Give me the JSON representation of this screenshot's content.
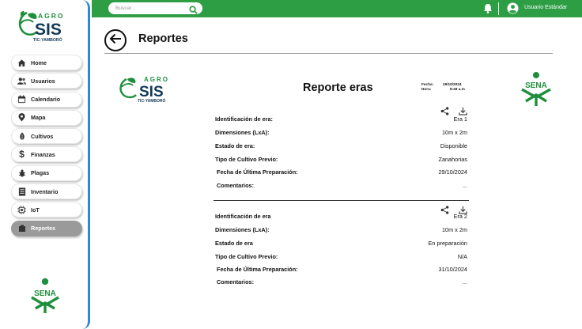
{
  "app": {
    "logo": {
      "word1": "AGRO",
      "word2": "SIS",
      "word3": "TIC-YAMBORÓ"
    },
    "sena_logo": "SENA"
  },
  "sidebar": {
    "items": [
      {
        "label": "Home",
        "icon": "home-icon"
      },
      {
        "label": "Usuarios",
        "icon": "users-icon"
      },
      {
        "label": "Calendario",
        "icon": "calendar-icon"
      },
      {
        "label": "Mapa",
        "icon": "map-pin-icon"
      },
      {
        "label": "Cultivos",
        "icon": "leaf-icon"
      },
      {
        "label": "Finanzas",
        "icon": "dollar-icon"
      },
      {
        "label": "Plagas",
        "icon": "bug-icon"
      },
      {
        "label": "Inventario",
        "icon": "inventory-icon"
      },
      {
        "label": "IoT",
        "icon": "chip-icon"
      },
      {
        "label": "Reportes",
        "icon": "report-icon",
        "active": true
      }
    ]
  },
  "topbar": {
    "search_placeholder": "Buscar...",
    "user_name": "Usuario Estándar",
    "color": "#2e9e45"
  },
  "page": {
    "title": "Reportes"
  },
  "report": {
    "title": "Reporte eras",
    "date_label": "Fecha:",
    "date_value": "29/10/2024",
    "time_label": "Hora:",
    "time_value": "8:49 a.m",
    "records": [
      {
        "fields": [
          {
            "label": "Identificación de era:",
            "value": "Era 1"
          },
          {
            "label": "Dimensiones (LxA):",
            "value": "10m x 2m"
          },
          {
            "label": "Estado de era:",
            "value": "Disponible"
          },
          {
            "label": "Tipo de Cultivo Previo:",
            "value": "Zanahorias"
          },
          {
            "label": "Fecha de Última Preparación:",
            "value": "29/10/2024"
          },
          {
            "label": "Comentarios:",
            "value": "..."
          }
        ]
      },
      {
        "fields": [
          {
            "label": "Identificación de era",
            "value": "Era 2"
          },
          {
            "label": "Dimensiones (LxA):",
            "value": "10m x 2m"
          },
          {
            "label": "Estado de era",
            "value": "En preparación"
          },
          {
            "label": "Tipo de Cultivo Previo:",
            "value": "N/A"
          },
          {
            "label": "Fecha de Última Preparación:",
            "value": "31/10/2024"
          },
          {
            "label": "Comentarios:",
            "value": "..."
          }
        ]
      }
    ]
  }
}
